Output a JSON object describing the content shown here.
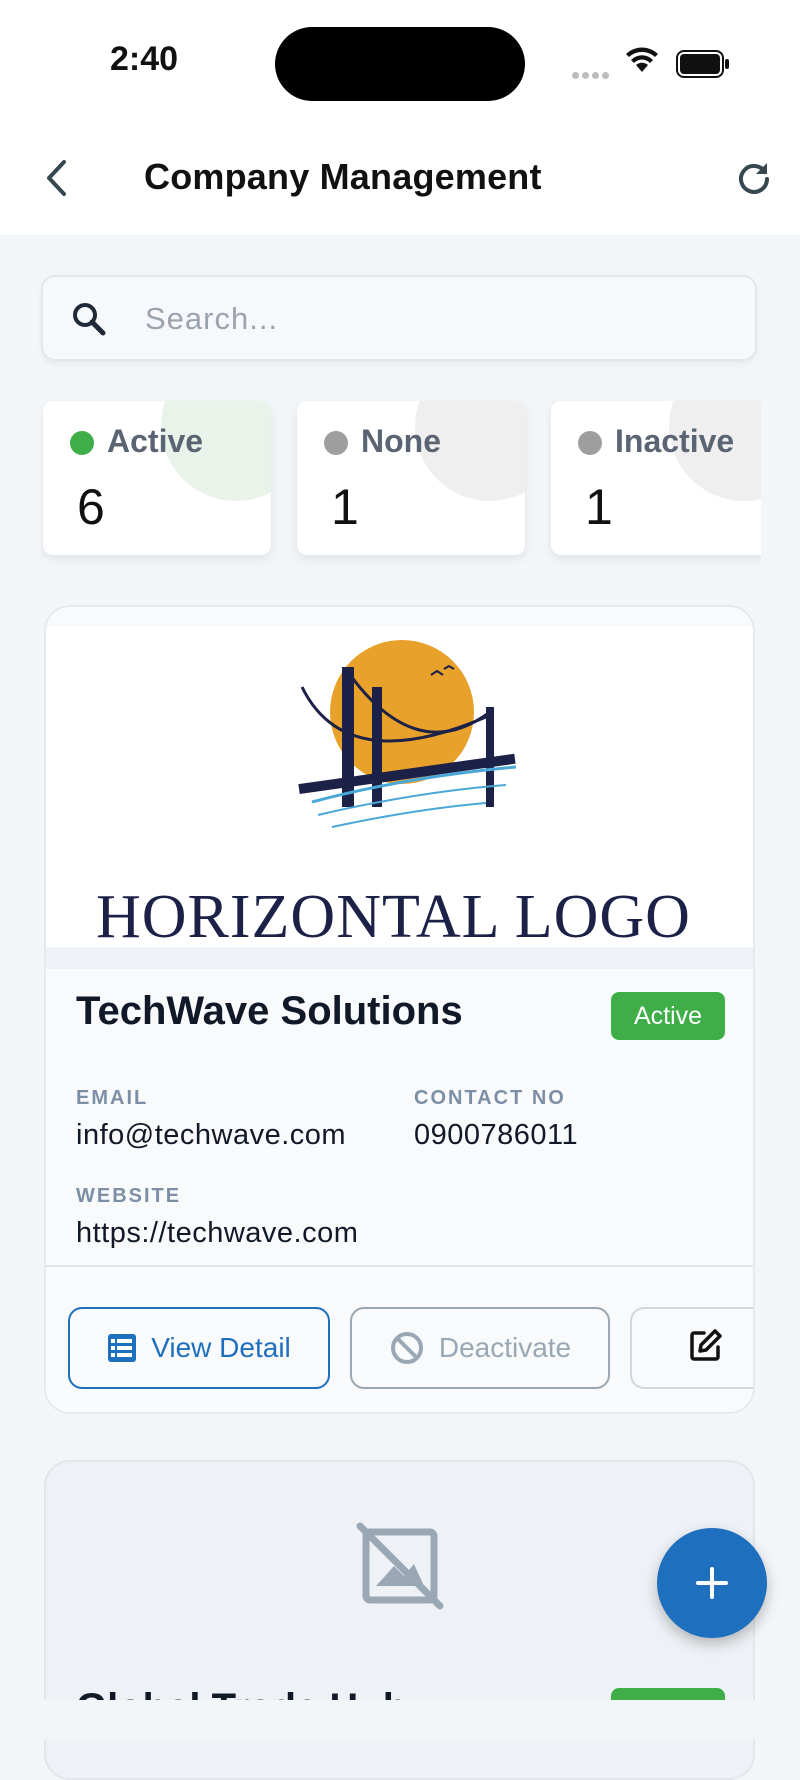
{
  "status_bar": {
    "time": "2:40"
  },
  "header": {
    "title": "Company Management"
  },
  "search": {
    "placeholder": "Search..."
  },
  "stats": [
    {
      "label": "Active",
      "value": "6",
      "dot_color": "#3fae49"
    },
    {
      "label": "None",
      "value": "1",
      "dot_color": "#9e9e9e"
    },
    {
      "label": "Inactive",
      "value": "1",
      "dot_color": "#9e9e9e"
    }
  ],
  "companies": [
    {
      "logo_text": "HORIZONTAL LOGO",
      "name": "TechWave Solutions",
      "status": "Active",
      "email_label": "EMAIL",
      "email": "info@techwave.com",
      "contact_label": "CONTACT NO",
      "contact": "0900786011",
      "website_label": "WEBSITE",
      "website": "https://techwave.com",
      "actions": {
        "view": "View Detail",
        "deactivate": "Deactivate"
      }
    },
    {
      "name": "Global Trade Hub"
    }
  ],
  "colors": {
    "primary": "#1f6fbf",
    "active_green": "#3fae49",
    "muted": "#9aa7b5"
  },
  "icons": {
    "back": "chevron-left-icon",
    "refresh": "refresh-icon",
    "search": "search-icon",
    "view": "table-icon",
    "deactivate": "block-icon",
    "edit": "edit-icon",
    "no_image": "image-not-supported-icon",
    "fab": "plus-icon"
  }
}
